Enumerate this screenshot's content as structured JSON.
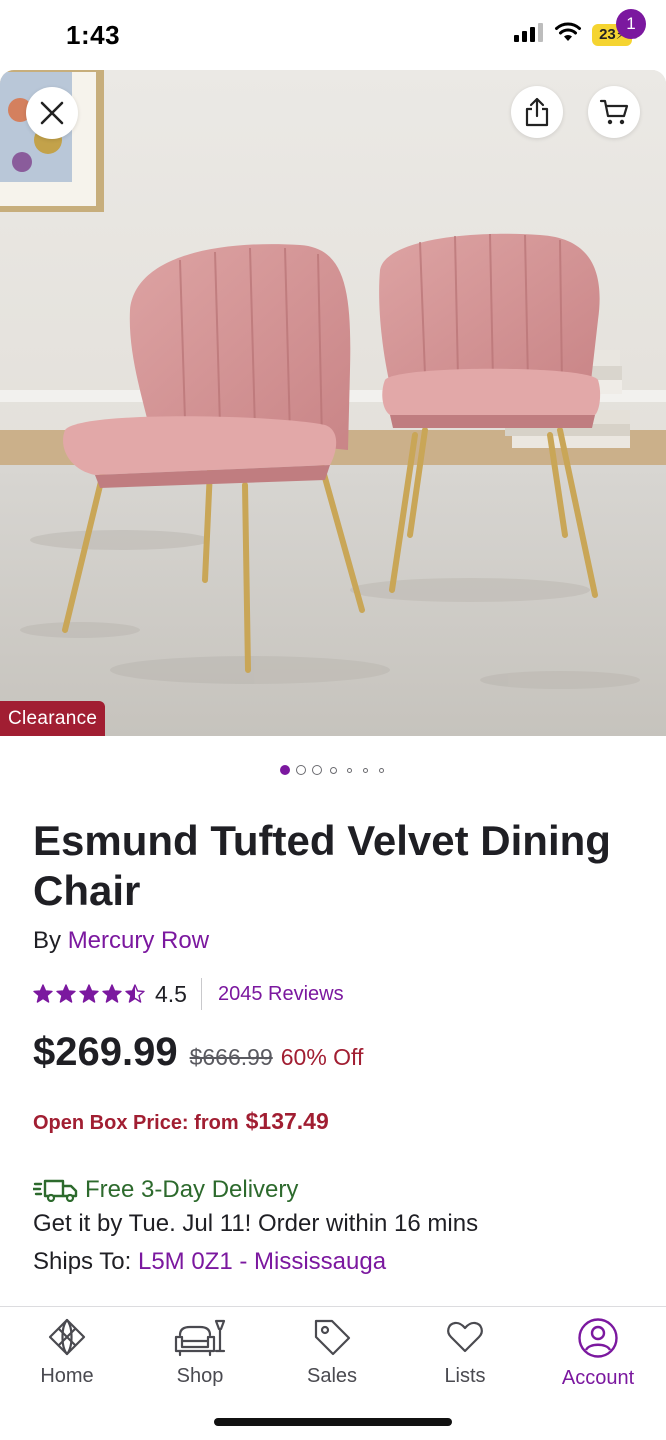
{
  "status_bar": {
    "time": "1:43",
    "battery": "23",
    "icons": [
      "cellular-signal-icon",
      "wifi-icon",
      "battery-charging-icon"
    ]
  },
  "hero": {
    "image_description_icon": "product-photo",
    "badge": "Clearance",
    "cart_count": "1",
    "icons": [
      "close-icon",
      "share-icon",
      "cart-icon"
    ],
    "carousel": {
      "total": 7,
      "active_index": 0
    }
  },
  "product": {
    "title": "Esmund Tufted Velvet Dining Chair",
    "by_prefix": "By",
    "brand": "Mercury Row",
    "rating": "4.5",
    "rating_fraction": 0.9,
    "reviews": "2045 Reviews",
    "price": "$269.99",
    "old_price": "$666.99",
    "discount": "60% Off",
    "open_box_label": "Open Box Price: from",
    "open_box_price": "$137.49",
    "delivery_label": "Free 3-Day Delivery",
    "delivery_estimate": "Get it by Tue. Jul 11! Order within 16 mins",
    "ships_to_prefix": "Ships To:",
    "ships_to_location": "L5M 0Z1 - Mississauga"
  },
  "bottom_nav": {
    "items": [
      {
        "label": "Home",
        "icon": "home-icon"
      },
      {
        "label": "Shop",
        "icon": "shop-icon"
      },
      {
        "label": "Sales",
        "icon": "sales-tag-icon"
      },
      {
        "label": "Lists",
        "icon": "heart-icon"
      },
      {
        "label": "Account",
        "icon": "account-icon"
      }
    ],
    "active": "Account"
  },
  "colors": {
    "accent": "#7b189f",
    "sale_red": "#a11e32",
    "delivery_green": "#2d6a2d",
    "chair_pink": "#d99a9c",
    "leg_gold": "#c9a657"
  }
}
